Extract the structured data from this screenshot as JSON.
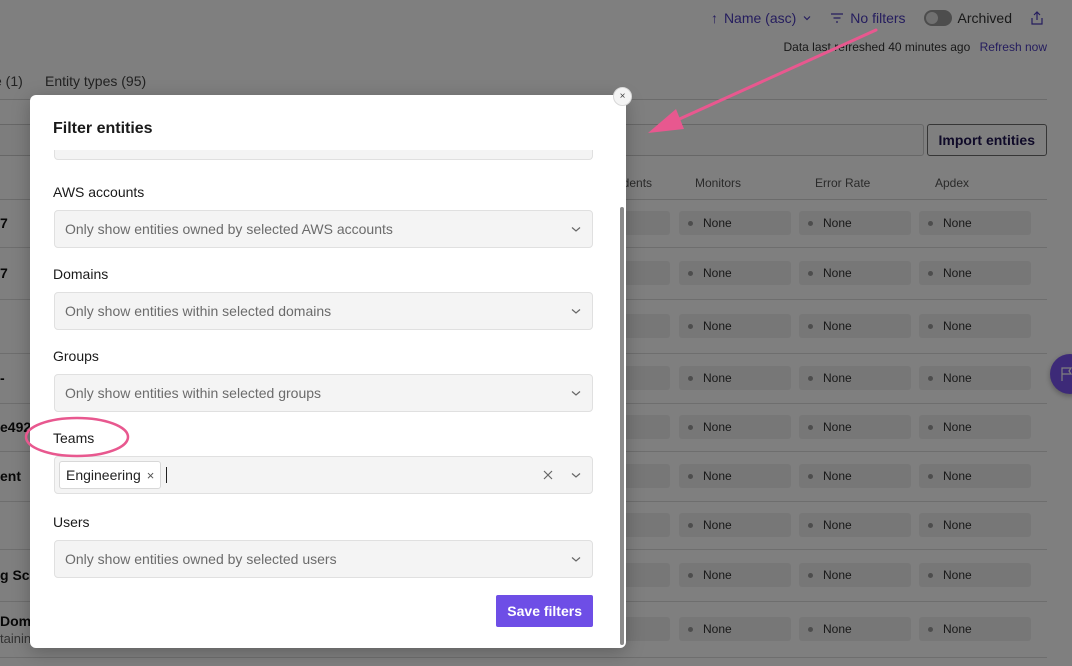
{
  "topbar": {
    "sort_label": "Name (asc)",
    "sort_icon": "arrow-up-icon",
    "filters_label": "No filters",
    "filters_icon": "filter-lines-icon",
    "archived_label": "Archived",
    "archived_on": false,
    "share_icon": "share-upload-icon",
    "refresh_text": "Data last refreshed 40 minutes ago",
    "refresh_link": "Refresh now"
  },
  "tabs": [
    {
      "label": "e (1)"
    },
    {
      "label": "Entity types (95)"
    }
  ],
  "actions": {
    "import_label": "Import entities"
  },
  "table": {
    "columns": [
      "idents",
      "Monitors",
      "Error Rate",
      "Apdex"
    ],
    "rows": [
      {
        "name": "7",
        "sub": "",
        "monitors": "None",
        "error_rate": "None",
        "apdex": "None"
      },
      {
        "name": "7",
        "sub": "",
        "monitors": "None",
        "error_rate": "None",
        "apdex": "None"
      },
      {
        "name": "",
        "sub": "",
        "monitors": "None",
        "error_rate": "None",
        "apdex": "None"
      },
      {
        "name": "-",
        "sub": "",
        "monitors": "None",
        "error_rate": "None",
        "apdex": "None"
      },
      {
        "name": "e492",
        "sub": "",
        "monitors": "None",
        "error_rate": "None",
        "apdex": "None"
      },
      {
        "name": "ent",
        "sub": "",
        "monitors": "None",
        "error_rate": "None",
        "apdex": "None"
      },
      {
        "name": "",
        "sub": "",
        "monitors": "None",
        "error_rate": "None",
        "apdex": "None"
      },
      {
        "name": "g Sca",
        "sub": "",
        "monitors": "None",
        "error_rate": "None",
        "apdex": "None"
      },
      {
        "name": "Doma",
        "sub": "tainin",
        "monitors": "None",
        "error_rate": "None",
        "apdex": "None"
      }
    ]
  },
  "modal": {
    "title": "Filter entities",
    "close_label": "×",
    "fields": [
      {
        "label": "AWS accounts",
        "placeholder": "Only show entities owned by selected AWS accounts"
      },
      {
        "label": "Domains",
        "placeholder": "Only show entities within selected domains"
      },
      {
        "label": "Groups",
        "placeholder": "Only show entities within selected groups"
      },
      {
        "label": "Teams",
        "selected": [
          "Engineering"
        ],
        "chip_remove": "×"
      },
      {
        "label": "Users",
        "placeholder": "Only show entities owned by selected users"
      }
    ],
    "save_label": "Save filters"
  },
  "colors": {
    "accent": "#6e4ee6",
    "link": "#4b3bbd",
    "annotation": "#e8588f",
    "fab": "#7b55f0"
  }
}
